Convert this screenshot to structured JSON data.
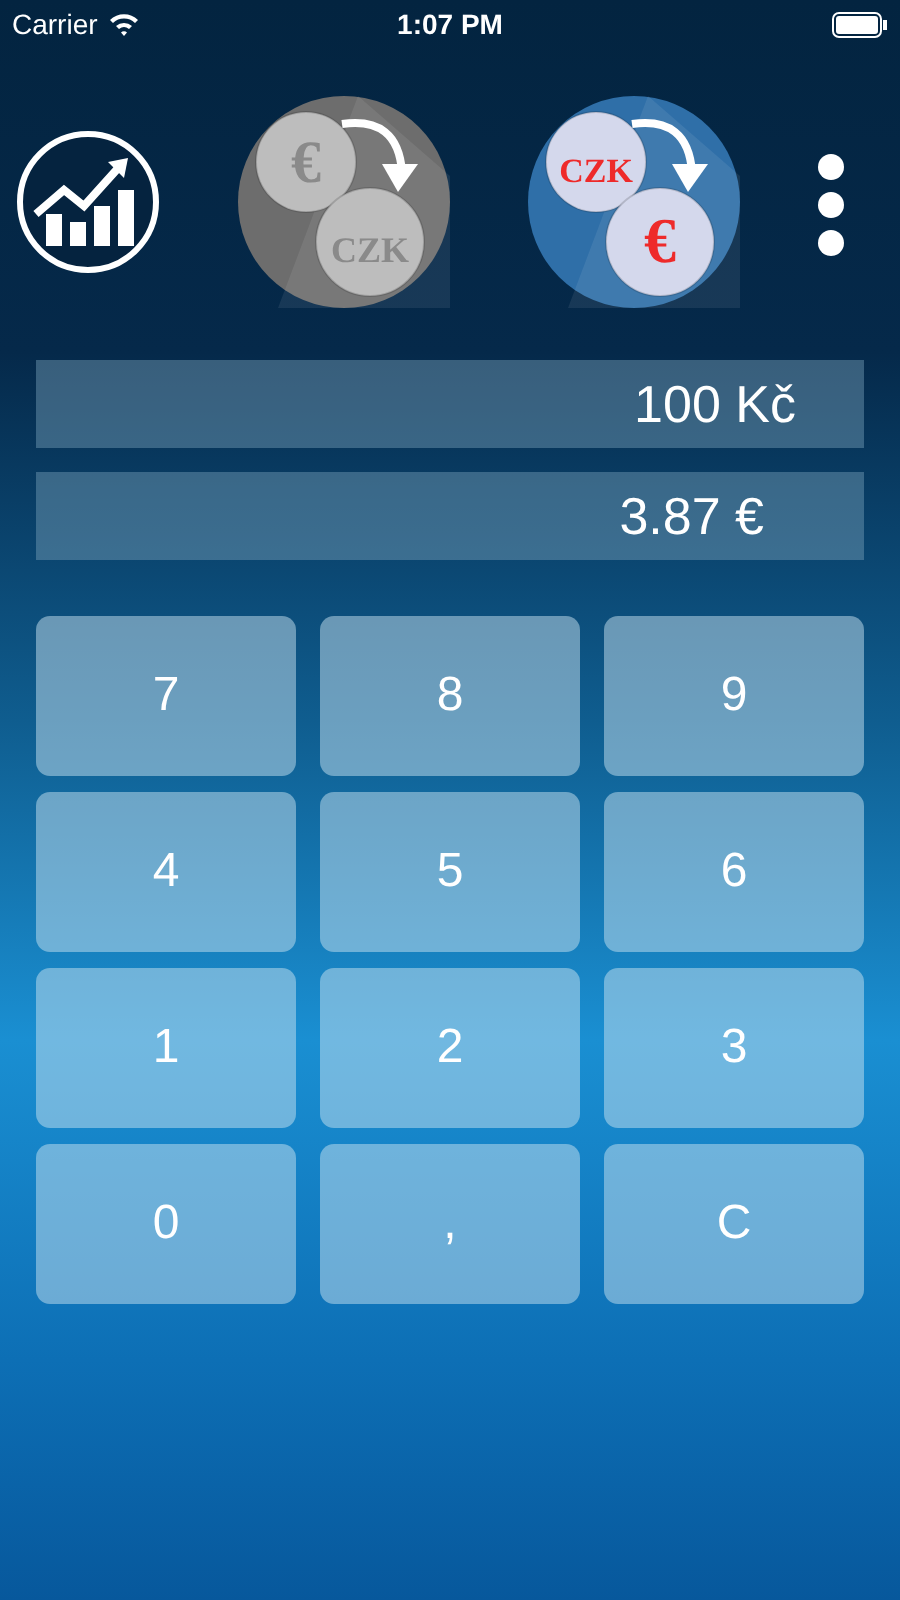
{
  "status_bar": {
    "carrier": "Carrier",
    "time": "1:07 PM"
  },
  "modes": [
    {
      "from": "€",
      "to": "CZK",
      "selected": false
    },
    {
      "from": "CZK",
      "to": "€",
      "selected": true
    }
  ],
  "display": [
    "100 Kč",
    "3.87 €"
  ],
  "keys": [
    "7",
    "8",
    "9",
    "4",
    "5",
    "6",
    "1",
    "2",
    "3",
    "0",
    ",",
    "C"
  ]
}
